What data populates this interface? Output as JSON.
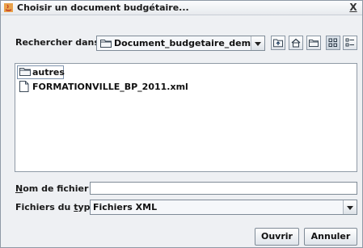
{
  "window": {
    "title": "Choisir un document budgétaire...",
    "close_glyph": "X"
  },
  "look_in": {
    "label_pre": "Rechercher dans :",
    "value": "Document_budgetaire_demat"
  },
  "toolbar": {
    "buttons": [
      "up-one-level-icon",
      "home-icon",
      "new-folder-icon",
      "list-view-icon",
      "details-view-icon"
    ]
  },
  "files": [
    {
      "name": "autres",
      "type": "folder"
    },
    {
      "name": "FORMATIONVILLE_BP_2011.xml",
      "type": "file"
    }
  ],
  "filename": {
    "label_mnemonic": "N",
    "label_rest": "om de fichier :",
    "value": ""
  },
  "filetype": {
    "label_pre": "Fichiers du ",
    "label_mnemonic": "t",
    "label_rest": "ype :",
    "value": "Fichiers XML"
  },
  "buttons": {
    "open": "Ouvrir",
    "cancel": "Annuler"
  }
}
